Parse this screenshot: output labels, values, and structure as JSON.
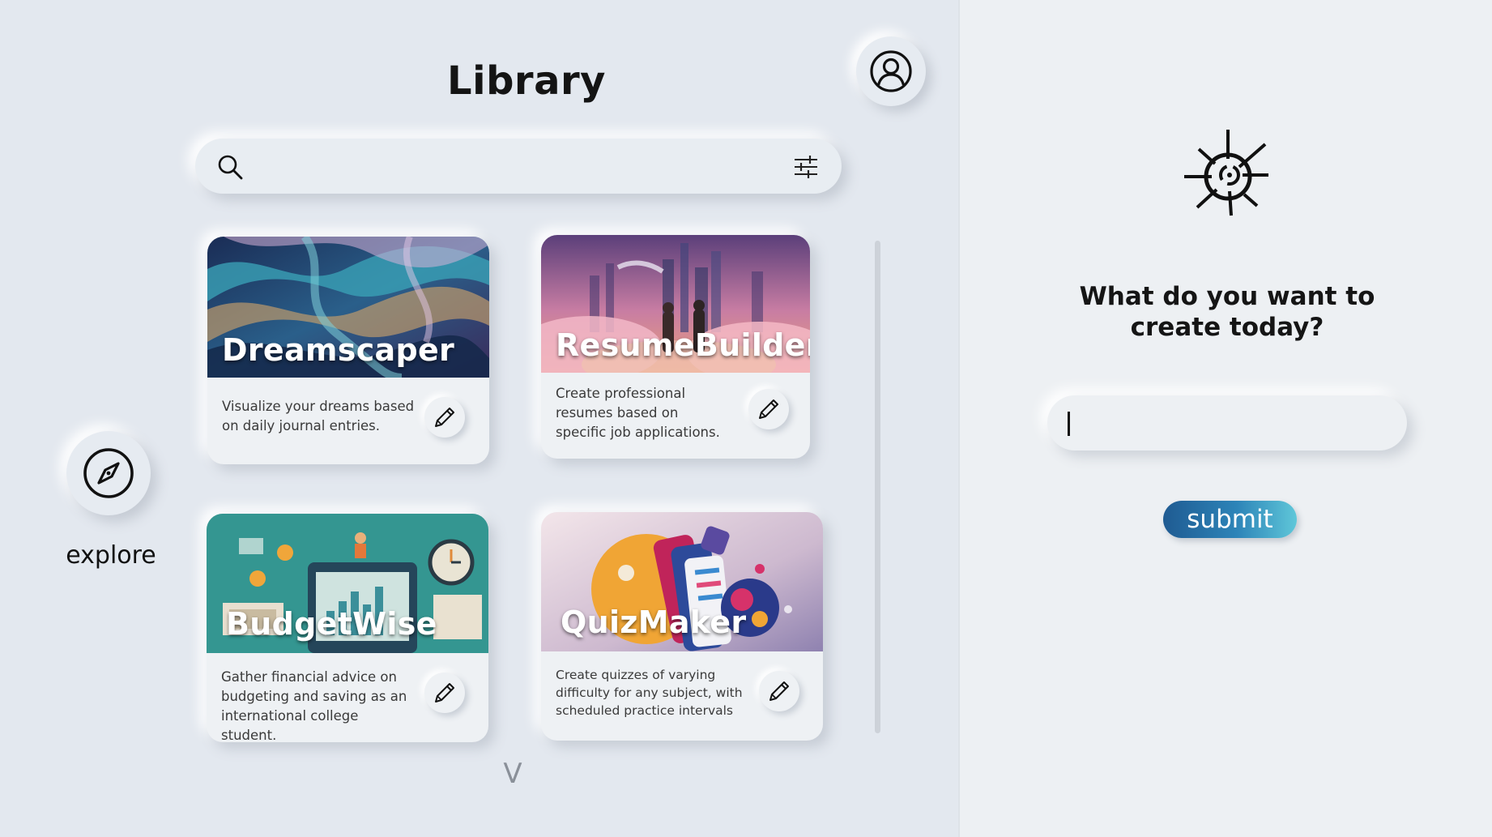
{
  "header": {
    "title": "Library"
  },
  "search": {
    "placeholder": "",
    "value": ""
  },
  "icons": {
    "account": "user-circle-icon",
    "search": "search-icon",
    "filter": "sliders-icon",
    "edit": "pencil-icon",
    "explore": "compass-icon",
    "more": "chevron-down-icon",
    "logo": "aperture-logo-icon"
  },
  "cards": [
    {
      "title": "Dreamscaper",
      "description": "Visualize your dreams based on daily journal entries."
    },
    {
      "title": "ResumeBuilder",
      "description": "Create professional resumes based on specific job applications."
    },
    {
      "title": "BudgetWise",
      "description": "Gather financial advice on budgeting and saving as an international college student."
    },
    {
      "title": "QuizMaker",
      "description": "Create quizzes of varying difficulty for any subject, with scheduled practice intervals"
    }
  ],
  "more": {
    "label": "V"
  },
  "explore": {
    "label": "explore"
  },
  "create": {
    "prompt": "What do you want to create today?",
    "input_value": "",
    "submit_label": "submit"
  },
  "colors": {
    "left_bg": "#e3e8ef",
    "right_bg": "#edf0f3",
    "submit_gradient_start": "#1f5b92",
    "submit_gradient_end": "#5fc7d9"
  }
}
